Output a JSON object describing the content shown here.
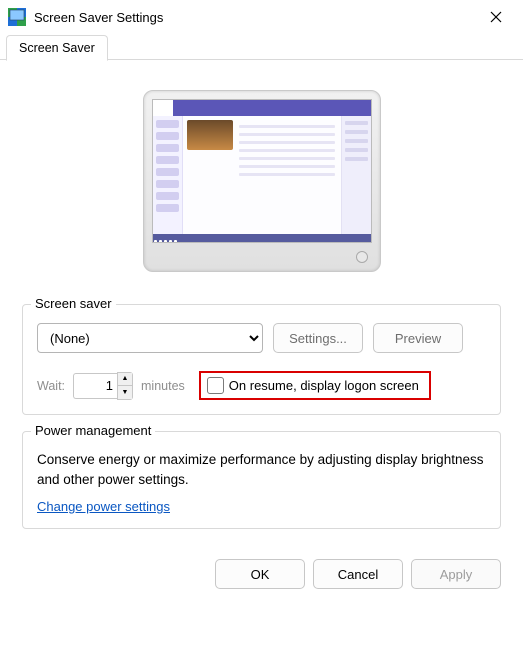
{
  "window": {
    "title": "Screen Saver Settings",
    "close_icon": "close-icon"
  },
  "tabs": {
    "screen_saver": "Screen Saver"
  },
  "screensaver_group": {
    "legend": "Screen saver",
    "selected": "(None)",
    "settings_btn": "Settings...",
    "preview_btn": "Preview",
    "wait_label": "Wait:",
    "wait_value": "1",
    "wait_units": "minutes",
    "resume_checkbox_label": "On resume, display logon screen",
    "resume_checked": false
  },
  "power_group": {
    "legend": "Power management",
    "text": "Conserve energy or maximize performance by adjusting display brightness and other power settings.",
    "link": "Change power settings"
  },
  "buttons": {
    "ok": "OK",
    "cancel": "Cancel",
    "apply": "Apply"
  }
}
